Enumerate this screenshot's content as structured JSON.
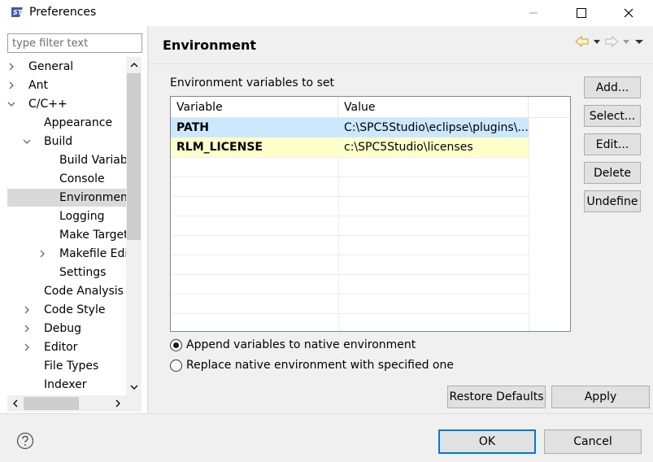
{
  "window": {
    "title": "Preferences"
  },
  "filter": {
    "placeholder": "type filter text"
  },
  "tree": {
    "items": [
      {
        "label": "General",
        "level": 0,
        "expander": "collapsed"
      },
      {
        "label": "Ant",
        "level": 0,
        "expander": "collapsed"
      },
      {
        "label": "C/C++",
        "level": 0,
        "expander": "expanded"
      },
      {
        "label": "Appearance",
        "level": 1,
        "expander": "none"
      },
      {
        "label": "Build",
        "level": 1,
        "expander": "expanded"
      },
      {
        "label": "Build Variables",
        "level": 2,
        "expander": "none"
      },
      {
        "label": "Console",
        "level": 2,
        "expander": "none"
      },
      {
        "label": "Environment",
        "level": 2,
        "expander": "none",
        "selected": true
      },
      {
        "label": "Logging",
        "level": 2,
        "expander": "none"
      },
      {
        "label": "Make Targets",
        "level": 2,
        "expander": "none"
      },
      {
        "label": "Makefile Editor",
        "level": 2,
        "expander": "collapsed"
      },
      {
        "label": "Settings",
        "level": 2,
        "expander": "none"
      },
      {
        "label": "Code Analysis",
        "level": 1,
        "expander": "none"
      },
      {
        "label": "Code Style",
        "level": 1,
        "expander": "collapsed"
      },
      {
        "label": "Debug",
        "level": 1,
        "expander": "collapsed"
      },
      {
        "label": "Editor",
        "level": 1,
        "expander": "collapsed"
      },
      {
        "label": "File Types",
        "level": 1,
        "expander": "none"
      },
      {
        "label": "Indexer",
        "level": 1,
        "expander": "none"
      }
    ]
  },
  "page": {
    "title": "Environment",
    "section_label": "Environment variables to set",
    "table": {
      "headers": [
        "Variable",
        "Value"
      ],
      "rows": [
        {
          "variable": "PATH",
          "value": "C:\\SPC5Studio\\eclipse\\plugins\\...",
          "state": "selected"
        },
        {
          "variable": "RLM_LICENSE",
          "value": "c:\\SPC5Studio\\licenses",
          "state": "highlight"
        }
      ]
    },
    "side_buttons": {
      "add": "Add...",
      "select": "Select...",
      "edit": "Edit...",
      "delete": "Delete",
      "undefine": "Undefine"
    },
    "radio": {
      "append": "Append variables to native environment",
      "replace": "Replace native environment with specified one",
      "selected": "append"
    },
    "restore_defaults": "Restore Defaults",
    "apply": "Apply"
  },
  "footer": {
    "ok": "OK",
    "cancel": "Cancel"
  },
  "colors": {
    "selection": "#cce8ff",
    "highlight": "#ffffcc",
    "tree_selection": "#d9d9d9",
    "accent": "#0078d7"
  }
}
